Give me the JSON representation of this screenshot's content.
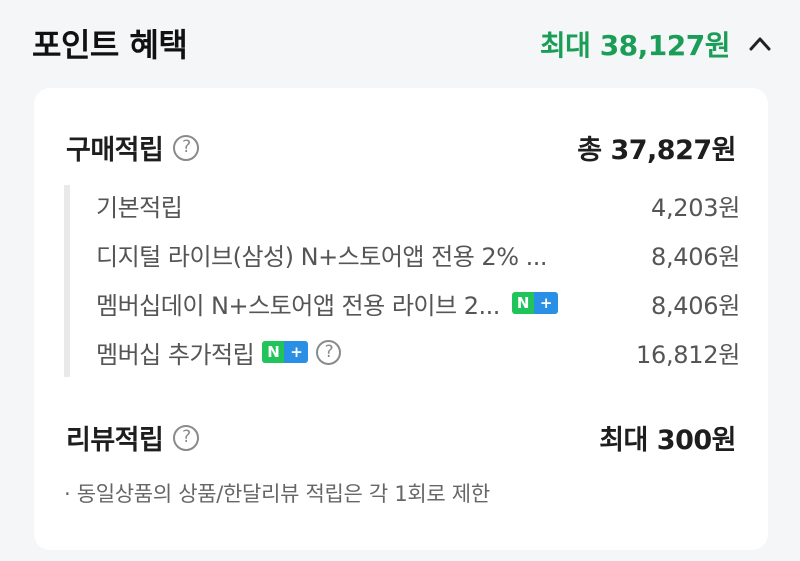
{
  "header": {
    "title": "포인트 혜택",
    "max_amount": "최대 38,127원",
    "accent_color": "#1a9e57",
    "toggle_icon": "chevron-up-icon"
  },
  "purchase": {
    "label": "구매적립",
    "help_icon": "question-circle-icon",
    "total": "총 37,827원",
    "items": [
      {
        "label": "기본적립",
        "value": "4,203원"
      },
      {
        "label": "디지털 라이브(삼성) N+스토어앱 전용 2% ...",
        "value": "8,406원"
      },
      {
        "label": "멤버십데이 N+스토어앱 전용 라이브 2...",
        "value": "8,406원",
        "badge": true
      },
      {
        "label": "멤버십 추가적립",
        "value": "16,812원",
        "badge": true,
        "help": true
      }
    ],
    "badge": {
      "n": "N",
      "plus": "+"
    }
  },
  "review": {
    "label": "리뷰적립",
    "help_icon": "question-circle-icon",
    "max": "최대 300원",
    "note": "· 동일상품의 상품/한달리뷰 적립은 각 1회로 제한"
  }
}
